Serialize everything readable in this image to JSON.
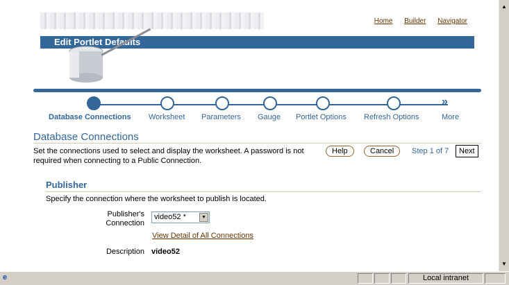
{
  "header": {
    "links": [
      "Home",
      "Builder",
      "Navigator"
    ],
    "title": "Edit Portlet Defaults"
  },
  "train": {
    "steps": [
      {
        "label": "Database Connections",
        "active": true
      },
      {
        "label": "Worksheet",
        "active": false
      },
      {
        "label": "Parameters",
        "active": false
      },
      {
        "label": "Gauge",
        "active": false
      },
      {
        "label": "Portlet Options",
        "active": false
      },
      {
        "label": "Refresh Options",
        "active": false
      },
      {
        "label": "More",
        "active": false
      }
    ],
    "more_icon": "double-chevron-right-icon"
  },
  "section": {
    "title": "Database Connections",
    "description": "Set the connections used to select and display the worksheet. A password is not required when connecting to a Public Connection.",
    "help_label": "Help",
    "cancel_label": "Cancel",
    "step_text": "Step 1 of 7",
    "next_label": "Next"
  },
  "publisher": {
    "title": "Publisher",
    "description": "Specify the connection where the worksheet to publish is located.",
    "connection_label": "Publisher's Connection",
    "connection_value": "video52 *",
    "view_link": "View Detail of All Connections",
    "description_label": "Description",
    "description_value": "video52"
  },
  "statusbar": {
    "zone": "Local intranet"
  },
  "colors": {
    "accent": "#336699",
    "link": "#663300"
  }
}
